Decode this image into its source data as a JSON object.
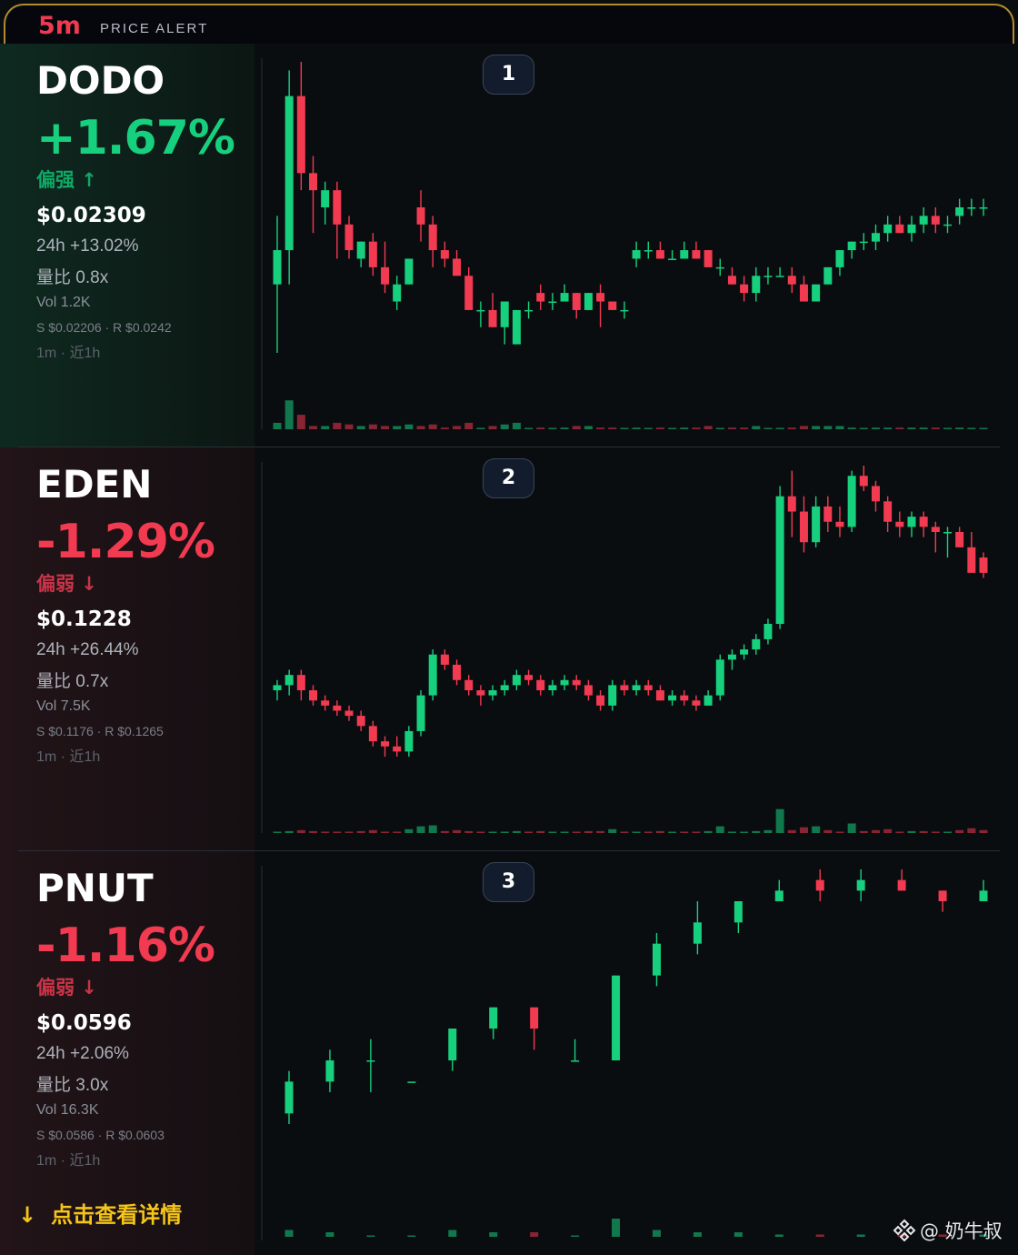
{
  "header": {
    "timeframe": "5m",
    "label": "PRICE ALERT"
  },
  "colors": {
    "up": "#17d07e",
    "down": "#f23a51",
    "accent": "#f5c518",
    "border": "#b38a2e"
  },
  "panels": [
    {
      "rank": "1",
      "symbol": "DODO",
      "change_pct": "+1.67%",
      "bias": "偏强 ↑",
      "direction": "up",
      "price": "$0.02309",
      "change_24h": "24h +13.02%",
      "volume_ratio": "量比 0.8x",
      "volume": "Vol 1.2K",
      "support_resistance": "S $0.02206 · R $0.0242",
      "timeframe_note": "1m · 近1h"
    },
    {
      "rank": "2",
      "symbol": "EDEN",
      "change_pct": "-1.29%",
      "bias": "偏弱 ↓",
      "direction": "down",
      "price": "$0.1228",
      "change_24h": "24h +26.44%",
      "volume_ratio": "量比 0.7x",
      "volume": "Vol 7.5K",
      "support_resistance": "S $0.1176 · R $0.1265",
      "timeframe_note": "1m · 近1h"
    },
    {
      "rank": "3",
      "symbol": "PNUT",
      "change_pct": "-1.16%",
      "bias": "偏弱 ↓",
      "direction": "down",
      "price": "$0.0596",
      "change_24h": "24h +2.06%",
      "volume_ratio": "量比 3.0x",
      "volume": "Vol 16.3K",
      "support_resistance": "S $0.0586 · R $0.0603",
      "timeframe_note": "1m · 近1h"
    }
  ],
  "cta": {
    "arrow": "↓",
    "label": "点击查看详情"
  },
  "watermark": {
    "label": "@ 奶牛叔",
    "icon": "binance-square-icon"
  },
  "chart_data": [
    {
      "type": "candlestick",
      "title": "DODO",
      "candles": [
        [
          0.02305,
          0.02313,
          0.02297,
          0.02309
        ],
        [
          0.02309,
          0.0233,
          0.02305,
          0.02327
        ],
        [
          0.02327,
          0.02331,
          0.02316,
          0.02318
        ],
        [
          0.02318,
          0.0232,
          0.02311,
          0.02316
        ],
        [
          0.02314,
          0.02317,
          0.02312,
          0.02316
        ],
        [
          0.02316,
          0.02317,
          0.02308,
          0.02312
        ],
        [
          0.02312,
          0.02313,
          0.02308,
          0.02309
        ],
        [
          0.02308,
          0.0231,
          0.02307,
          0.0231
        ],
        [
          0.0231,
          0.02311,
          0.02306,
          0.02307
        ],
        [
          0.02307,
          0.0231,
          0.02304,
          0.02305
        ],
        [
          0.02303,
          0.02306,
          0.02302,
          0.02305
        ],
        [
          0.02305,
          0.02308,
          0.02305,
          0.02308
        ],
        [
          0.02314,
          0.02316,
          0.0231,
          0.02312
        ],
        [
          0.02312,
          0.02313,
          0.02307,
          0.02309
        ],
        [
          0.02309,
          0.0231,
          0.02307,
          0.02308
        ],
        [
          0.02308,
          0.02309,
          0.02306,
          0.02306
        ],
        [
          0.02306,
          0.02307,
          0.02302,
          0.02302
        ],
        [
          0.02302,
          0.02303,
          0.023,
          0.02302
        ],
        [
          0.02302,
          0.02304,
          0.023,
          0.023
        ],
        [
          0.023,
          0.02303,
          0.02298,
          0.02303
        ],
        [
          0.02298,
          0.02302,
          0.02298,
          0.02302
        ],
        [
          0.02302,
          0.02303,
          0.02301,
          0.02302
        ],
        [
          0.02304,
          0.02305,
          0.02302,
          0.02303
        ],
        [
          0.02303,
          0.02304,
          0.02302,
          0.02303
        ],
        [
          0.02303,
          0.02305,
          0.02303,
          0.02304
        ],
        [
          0.02304,
          0.02304,
          0.02301,
          0.02302
        ],
        [
          0.02302,
          0.02304,
          0.02302,
          0.02304
        ],
        [
          0.02304,
          0.02305,
          0.023,
          0.02303
        ],
        [
          0.02303,
          0.02303,
          0.02302,
          0.02302
        ],
        [
          0.02302,
          0.02303,
          0.02301,
          0.02302
        ],
        [
          0.02308,
          0.0231,
          0.02307,
          0.02309
        ],
        [
          0.02309,
          0.0231,
          0.02308,
          0.02309
        ],
        [
          0.02309,
          0.0231,
          0.02308,
          0.02308
        ],
        [
          0.02308,
          0.02309,
          0.02308,
          0.02308
        ],
        [
          0.02308,
          0.0231,
          0.02308,
          0.02309
        ],
        [
          0.02309,
          0.0231,
          0.02308,
          0.02308
        ],
        [
          0.02309,
          0.02309,
          0.02307,
          0.02307
        ],
        [
          0.02307,
          0.02308,
          0.02306,
          0.02307
        ],
        [
          0.02306,
          0.02307,
          0.02305,
          0.02305
        ],
        [
          0.02305,
          0.02306,
          0.02303,
          0.02304
        ],
        [
          0.02304,
          0.02307,
          0.02303,
          0.02306
        ],
        [
          0.02306,
          0.02307,
          0.02305,
          0.02306
        ],
        [
          0.02306,
          0.02307,
          0.02306,
          0.02306
        ],
        [
          0.02306,
          0.02307,
          0.02304,
          0.02305
        ],
        [
          0.02305,
          0.02306,
          0.02303,
          0.02303
        ],
        [
          0.02303,
          0.02305,
          0.02303,
          0.02305
        ],
        [
          0.02305,
          0.02307,
          0.02305,
          0.02307
        ],
        [
          0.02307,
          0.02309,
          0.02306,
          0.02309
        ],
        [
          0.02309,
          0.0231,
          0.02308,
          0.0231
        ],
        [
          0.0231,
          0.02311,
          0.02309,
          0.0231
        ],
        [
          0.0231,
          0.02312,
          0.02309,
          0.02311
        ],
        [
          0.02311,
          0.02313,
          0.0231,
          0.02312
        ],
        [
          0.02312,
          0.02313,
          0.02311,
          0.02311
        ],
        [
          0.02311,
          0.02313,
          0.0231,
          0.02312
        ],
        [
          0.02312,
          0.02314,
          0.02311,
          0.02313
        ],
        [
          0.02313,
          0.02314,
          0.02311,
          0.02312
        ],
        [
          0.02312,
          0.02313,
          0.02311,
          0.02312
        ],
        [
          0.02313,
          0.02315,
          0.02312,
          0.02314
        ],
        [
          0.02314,
          0.02315,
          0.02313,
          0.02314
        ],
        [
          0.02314,
          0.02315,
          0.02313,
          0.02314
        ]
      ]
    },
    {
      "type": "candlestick",
      "title": "EDEN",
      "candles": [
        [
          0.121,
          0.1212,
          0.1208,
          0.1211
        ],
        [
          0.1211,
          0.1214,
          0.1209,
          0.1213
        ],
        [
          0.1213,
          0.1214,
          0.1208,
          0.121
        ],
        [
          0.121,
          0.1211,
          0.1207,
          0.1208
        ],
        [
          0.1208,
          0.1209,
          0.1206,
          0.1207
        ],
        [
          0.1207,
          0.1208,
          0.1205,
          0.1206
        ],
        [
          0.1206,
          0.1207,
          0.1204,
          0.1205
        ],
        [
          0.1205,
          0.1206,
          0.1202,
          0.1203
        ],
        [
          0.1203,
          0.1204,
          0.1199,
          0.12
        ],
        [
          0.12,
          0.1201,
          0.1197,
          0.1199
        ],
        [
          0.1199,
          0.1201,
          0.1197,
          0.1198
        ],
        [
          0.1198,
          0.1203,
          0.1197,
          0.1202
        ],
        [
          0.1202,
          0.121,
          0.1201,
          0.1209
        ],
        [
          0.1209,
          0.1218,
          0.1208,
          0.1217
        ],
        [
          0.1217,
          0.1218,
          0.1214,
          0.1215
        ],
        [
          0.1215,
          0.1216,
          0.1211,
          0.1212
        ],
        [
          0.1212,
          0.1213,
          0.1209,
          0.121
        ],
        [
          0.121,
          0.1211,
          0.1207,
          0.1209
        ],
        [
          0.1209,
          0.1211,
          0.1208,
          0.121
        ],
        [
          0.121,
          0.1212,
          0.1209,
          0.1211
        ],
        [
          0.1211,
          0.1214,
          0.121,
          0.1213
        ],
        [
          0.1213,
          0.1214,
          0.1211,
          0.1212
        ],
        [
          0.1212,
          0.1213,
          0.1209,
          0.121
        ],
        [
          0.121,
          0.1212,
          0.1209,
          0.1211
        ],
        [
          0.1211,
          0.1213,
          0.121,
          0.1212
        ],
        [
          0.1212,
          0.1213,
          0.121,
          0.1211
        ],
        [
          0.1211,
          0.1212,
          0.1208,
          0.1209
        ],
        [
          0.1209,
          0.121,
          0.1206,
          0.1207
        ],
        [
          0.1207,
          0.1212,
          0.1206,
          0.1211
        ],
        [
          0.1211,
          0.1212,
          0.1209,
          0.121
        ],
        [
          0.121,
          0.1212,
          0.1209,
          0.1211
        ],
        [
          0.1211,
          0.1212,
          0.1209,
          0.121
        ],
        [
          0.121,
          0.1211,
          0.1208,
          0.1208
        ],
        [
          0.1208,
          0.121,
          0.1207,
          0.1209
        ],
        [
          0.1209,
          0.121,
          0.1207,
          0.1208
        ],
        [
          0.1208,
          0.1209,
          0.1206,
          0.1207
        ],
        [
          0.1207,
          0.121,
          0.1207,
          0.1209
        ],
        [
          0.1209,
          0.1217,
          0.1208,
          0.1216
        ],
        [
          0.1216,
          0.1218,
          0.1214,
          0.1217
        ],
        [
          0.1217,
          0.1219,
          0.1216,
          0.1218
        ],
        [
          0.1218,
          0.1221,
          0.1217,
          0.122
        ],
        [
          0.122,
          0.1224,
          0.1219,
          0.1223
        ],
        [
          0.1223,
          0.125,
          0.1222,
          0.1248
        ],
        [
          0.1248,
          0.1253,
          0.124,
          0.1245
        ],
        [
          0.1245,
          0.1248,
          0.1237,
          0.1239
        ],
        [
          0.1239,
          0.1248,
          0.1238,
          0.1246
        ],
        [
          0.1246,
          0.1248,
          0.1241,
          0.1243
        ],
        [
          0.1243,
          0.1246,
          0.124,
          0.1242
        ],
        [
          0.1242,
          0.1253,
          0.1241,
          0.1252
        ],
        [
          0.1252,
          0.1254,
          0.1249,
          0.125
        ],
        [
          0.125,
          0.1251,
          0.1245,
          0.1247
        ],
        [
          0.1247,
          0.1248,
          0.1241,
          0.1243
        ],
        [
          0.1243,
          0.1245,
          0.124,
          0.1242
        ],
        [
          0.1242,
          0.1245,
          0.124,
          0.1244
        ],
        [
          0.1244,
          0.1245,
          0.124,
          0.1242
        ],
        [
          0.1242,
          0.1243,
          0.1237,
          0.1241
        ],
        [
          0.1241,
          0.1242,
          0.1236,
          0.1241
        ],
        [
          0.1241,
          0.1242,
          0.1238,
          0.1238
        ],
        [
          0.1238,
          0.1241,
          0.1236,
          0.1233
        ],
        [
          0.1236,
          0.1237,
          0.1232,
          0.1233
        ]
      ]
    },
    {
      "type": "candlestick",
      "title": "PNUT",
      "candles": [
        [
          0.0581,
          0.0585,
          0.058,
          0.0584
        ],
        [
          0.0584,
          0.0587,
          0.0583,
          0.0586
        ],
        [
          0.0586,
          0.0588,
          0.0583,
          0.0586
        ],
        [
          0.0584,
          0.0584,
          0.0584,
          0.0584
        ],
        [
          0.0586,
          0.0589,
          0.0585,
          0.0589
        ],
        [
          0.0589,
          0.0591,
          0.0588,
          0.0591
        ],
        [
          0.0591,
          0.0591,
          0.0587,
          0.0589
        ],
        [
          0.0586,
          0.0588,
          0.0586,
          0.0586
        ],
        [
          0.0586,
          0.0594,
          0.0586,
          0.0594
        ],
        [
          0.0594,
          0.0598,
          0.0593,
          0.0597
        ],
        [
          0.0597,
          0.0601,
          0.0596,
          0.0599
        ],
        [
          0.0599,
          0.0601,
          0.0598,
          0.0601
        ],
        [
          0.0601,
          0.0603,
          0.0601,
          0.0602
        ],
        [
          0.0603,
          0.0604,
          0.0601,
          0.0602
        ],
        [
          0.0602,
          0.0604,
          0.0601,
          0.0603
        ],
        [
          0.0603,
          0.0604,
          0.0602,
          0.0602
        ],
        [
          0.0602,
          0.0602,
          0.06,
          0.0601
        ],
        [
          0.0601,
          0.0603,
          0.0601,
          0.0602
        ]
      ]
    }
  ]
}
